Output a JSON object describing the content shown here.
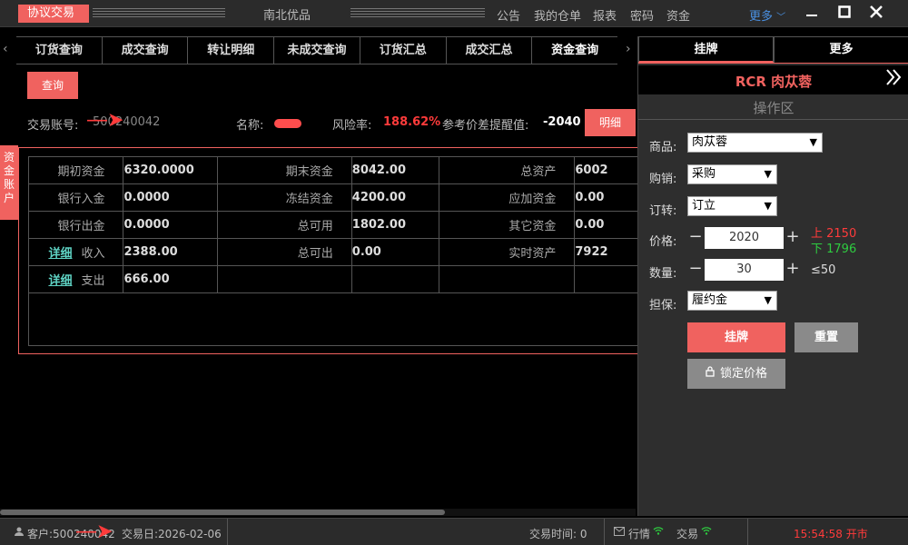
{
  "titlebar": {
    "app_name": "协议交易",
    "title": "南北优品",
    "nav": [
      "公告",
      "我的仓单",
      "报表",
      "密码",
      "资金"
    ],
    "more": "更多"
  },
  "tabs": [
    "订货查询",
    "成交查询",
    "转让明细",
    "未成交查询",
    "订货汇总",
    "成交汇总",
    "资金查询"
  ],
  "query_button": "查询",
  "account_info": {
    "account_label": "交易账号:",
    "account_value": "500240042",
    "name_label": "名称:",
    "risk_label": "风险率:",
    "risk_value": "188.62%",
    "ref_label": "参考价差提醒值:",
    "ref_value": "-2040",
    "detail_button": "明细"
  },
  "side_tag": "资金账户",
  "fund_table": [
    {
      "l1": "期初资金",
      "v1": "6320.0000",
      "l2": "期末资金",
      "v2": "8042.00",
      "l3": "总资产",
      "v3": "6002"
    },
    {
      "l1": "银行入金",
      "v1": "0.0000",
      "l2": "冻结资金",
      "v2": "4200.00",
      "l3": "应加资金",
      "v3": "0.00"
    },
    {
      "l1": "银行出金",
      "v1": "0.0000",
      "l2": "总可用",
      "v2": "1802.00",
      "l3": "其它资金",
      "v3": "0.00"
    },
    {
      "link": "详细",
      "l1": "收入",
      "v1": "2388.00",
      "l2": "总可出",
      "v2": "0.00",
      "l3": "实时资产",
      "v3": "7922"
    },
    {
      "link": "详细",
      "l1": "支出",
      "v1": "666.00"
    }
  ],
  "right_panel": {
    "tabs": [
      "挂牌",
      "更多"
    ],
    "product_title": "RCR 肉苁蓉",
    "op_area": "操作区",
    "product_label": "商品:",
    "product_value": "肉苁蓉",
    "buysell_label": "购销:",
    "buysell_value": "采购",
    "order_label": "订转:",
    "order_value": "订立",
    "price_label": "价格:",
    "price_value": "2020",
    "limit_up": "上 2150",
    "limit_down": "下 1796",
    "qty_label": "数量:",
    "qty_value": "30",
    "qty_max": "≤50",
    "guarantee_label": "担保:",
    "guarantee_value": "履约金",
    "list_button": "挂牌",
    "reset_button": "重置",
    "lock_button": "锁定价格"
  },
  "statusbar": {
    "customer": "客户:500240042",
    "trade_day": "交易日:2026-02-06",
    "trade_time": "交易时间: 0",
    "market": "行情",
    "trade": "交易",
    "clock": "15:54:58 开市"
  },
  "colors": {
    "accent": "#f0625f",
    "risk": "#ff3b3b",
    "down": "#2ecc40",
    "link": "#5fd3c4"
  }
}
